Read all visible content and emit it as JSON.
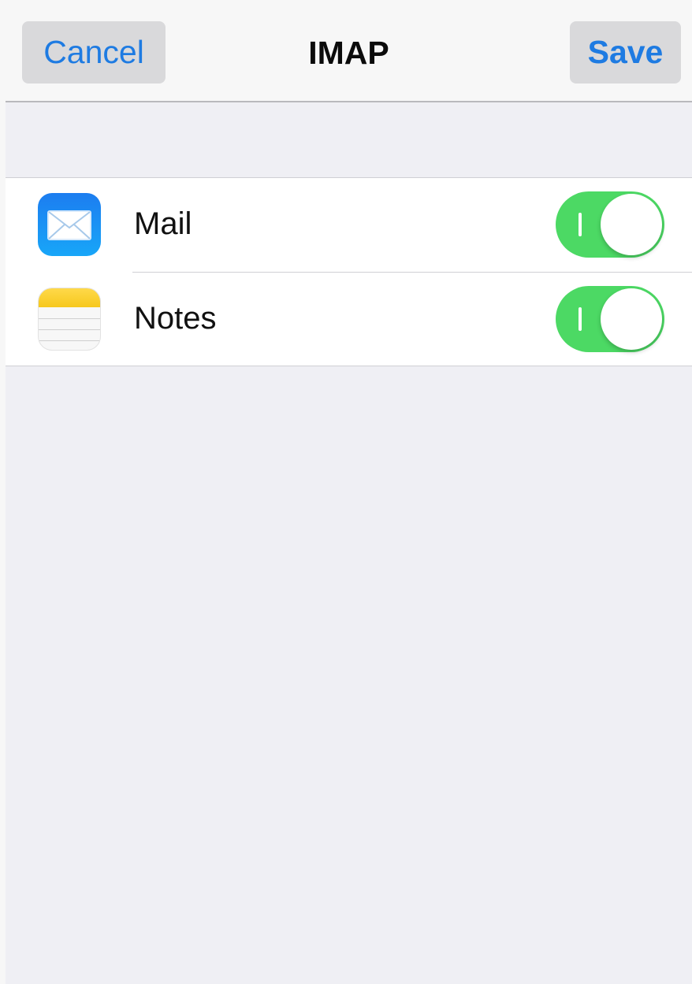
{
  "navbar": {
    "cancel_label": "Cancel",
    "title": "IMAP",
    "save_label": "Save"
  },
  "items": [
    {
      "label": "Mail",
      "icon": "mail-icon",
      "enabled": true
    },
    {
      "label": "Notes",
      "icon": "notes-icon",
      "enabled": true
    }
  ],
  "colors": {
    "accent": "#1e7be2",
    "toggle_on": "#4cd964",
    "background": "#efeff4"
  }
}
